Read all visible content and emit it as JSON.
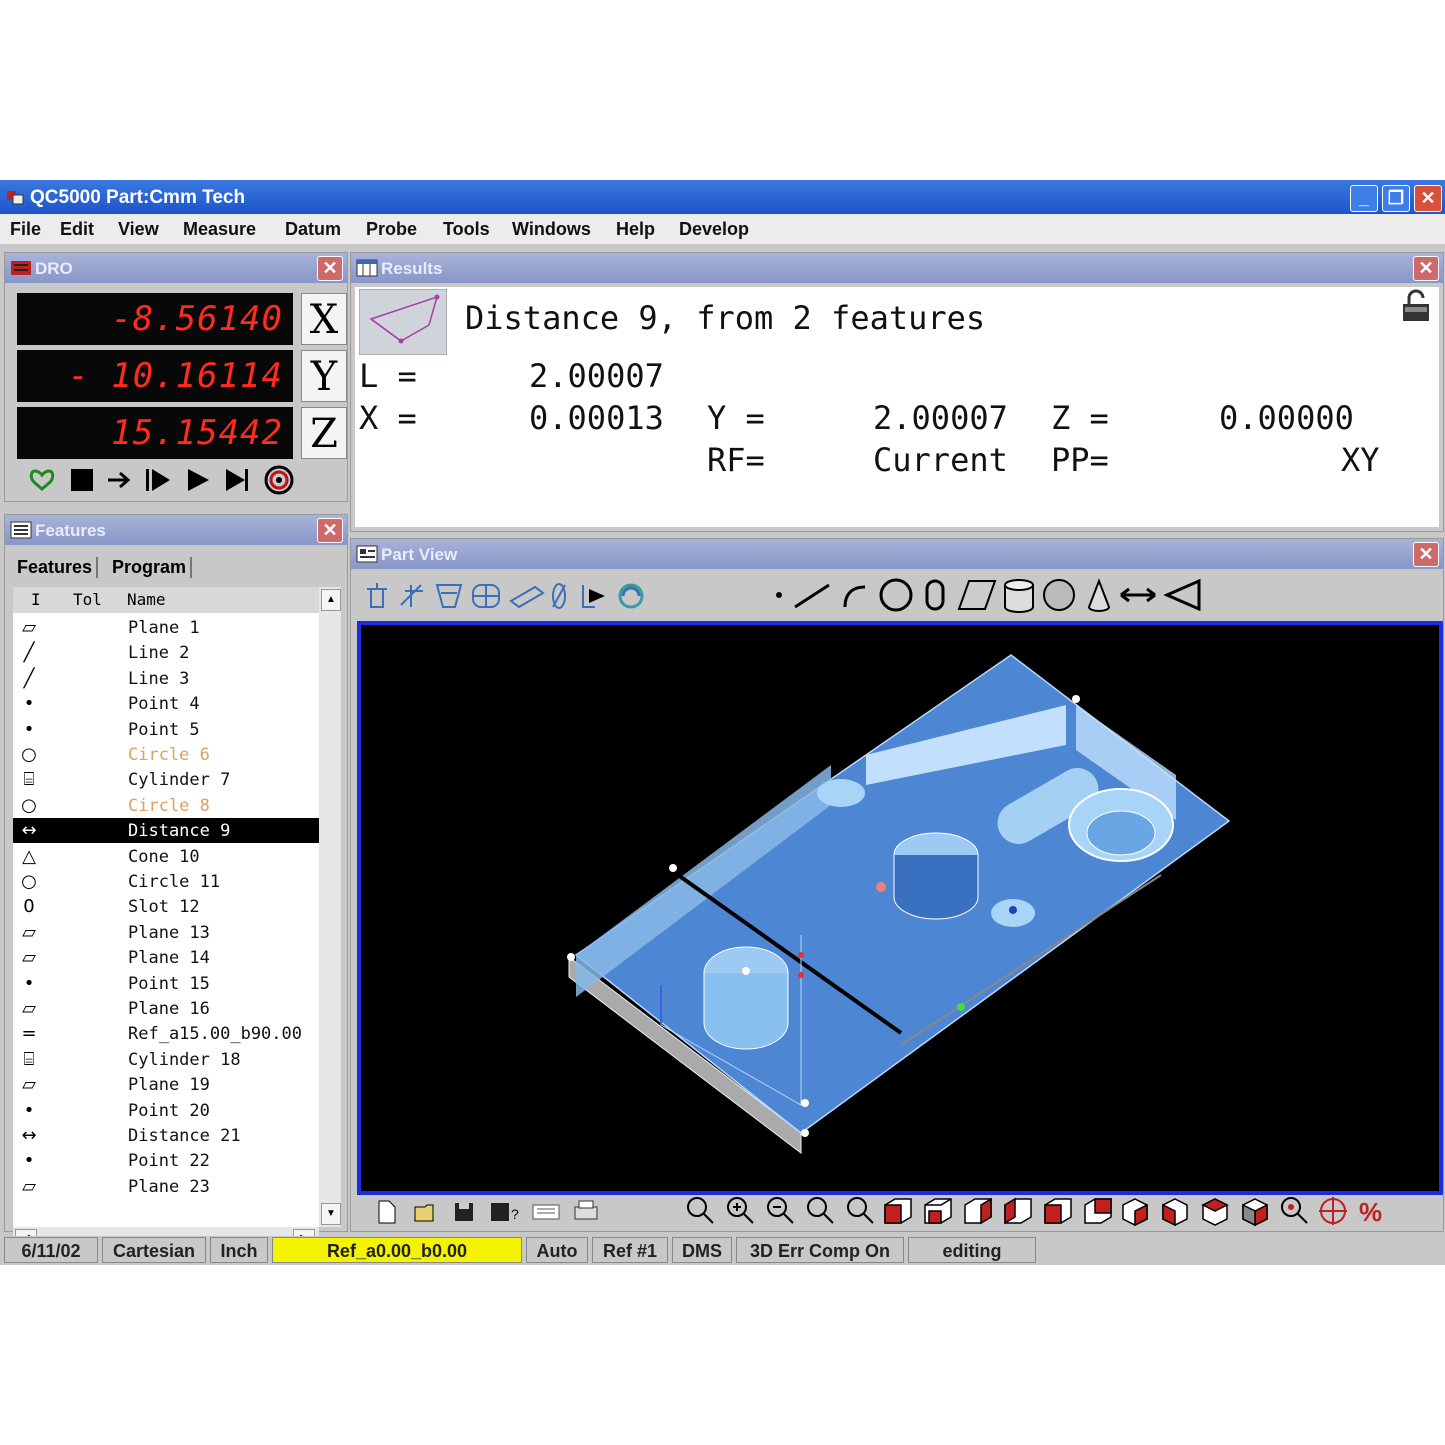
{
  "window": {
    "title": "QC5000 Part:Cmm Tech"
  },
  "menu": [
    "File",
    "Edit",
    "View",
    "Measure",
    "Datum",
    "Probe",
    "Tools",
    "Windows",
    "Help",
    "Develop"
  ],
  "dro": {
    "title": "DRO",
    "x": {
      "value": "-8.56140",
      "axis": "X"
    },
    "y": {
      "value": "- 10.16114",
      "axis": "Y"
    },
    "z": {
      "value": "15.15442",
      "axis": "Z"
    }
  },
  "results": {
    "title": "Results",
    "heading": "Distance 9, from 2 features",
    "l_label": "L =",
    "l_value": "2.00007",
    "x_label": "X =",
    "x_value": "0.00013",
    "y_label": "Y =",
    "y_value": "2.00007",
    "z_label": "Z =",
    "z_value": "0.00000",
    "rf_label": "RF=",
    "rf_value": "Current",
    "pp_label": "PP=",
    "pp_value": "XY"
  },
  "features": {
    "title": "Features",
    "tabs": [
      "Features",
      "Program"
    ],
    "columns": [
      "I",
      "Tol",
      "Name"
    ],
    "rows": [
      {
        "icon": "plane-icon",
        "glyph": "▱",
        "name": "Plane 1"
      },
      {
        "icon": "line-icon",
        "glyph": "╱",
        "name": "Line 2"
      },
      {
        "icon": "line-icon",
        "glyph": "╱",
        "name": "Line 3"
      },
      {
        "icon": "point-icon",
        "glyph": "•",
        "name": "Point 4"
      },
      {
        "icon": "point-icon",
        "glyph": "•",
        "name": "Point 5"
      },
      {
        "icon": "circle-icon",
        "glyph": "○",
        "name": "Circle 6",
        "highlight": "orange"
      },
      {
        "icon": "cylinder-icon",
        "glyph": "⌸",
        "name": "Cylinder 7"
      },
      {
        "icon": "circle-icon",
        "glyph": "○",
        "name": "Circle 8",
        "highlight": "orange"
      },
      {
        "icon": "distance-icon",
        "glyph": "↔",
        "name": "Distance 9",
        "highlight": "selected"
      },
      {
        "icon": "cone-icon",
        "glyph": "△",
        "name": "Cone 10"
      },
      {
        "icon": "circle-icon",
        "glyph": "○",
        "name": "Circle 11"
      },
      {
        "icon": "slot-icon",
        "glyph": "0",
        "name": "Slot 12"
      },
      {
        "icon": "plane-icon",
        "glyph": "▱",
        "name": "Plane 13"
      },
      {
        "icon": "plane-icon",
        "glyph": "▱",
        "name": "Plane 14"
      },
      {
        "icon": "point-icon",
        "glyph": "•",
        "name": "Point 15"
      },
      {
        "icon": "plane-icon",
        "glyph": "▱",
        "name": "Plane 16"
      },
      {
        "icon": "reference-icon",
        "glyph": "=",
        "name": "Ref_a15.00_b90.00"
      },
      {
        "icon": "cylinder-icon",
        "glyph": "⌸",
        "name": "Cylinder 18"
      },
      {
        "icon": "plane-icon",
        "glyph": "▱",
        "name": "Plane 19"
      },
      {
        "icon": "point-icon",
        "glyph": "•",
        "name": "Point 20"
      },
      {
        "icon": "distance-icon",
        "glyph": "↔",
        "name": "Distance 21"
      },
      {
        "icon": "point-icon",
        "glyph": "•",
        "name": "Point 22"
      },
      {
        "icon": "plane-icon",
        "glyph": "▱",
        "name": "Plane 23"
      }
    ]
  },
  "part_view": {
    "title": "Part View"
  },
  "status": [
    "6/11/02",
    "Cartesian",
    "Inch",
    "Ref_a0.00_b0.00",
    "Auto",
    "Ref #1",
    "DMS",
    "3D Err Comp On",
    "editing"
  ],
  "colors": {
    "title_bar": "#1d55c8",
    "dro_digits": "#ff2b1e",
    "viewport_border": "#1a2ee0",
    "status_highlight": "#f4f400",
    "selection": "#000000"
  }
}
